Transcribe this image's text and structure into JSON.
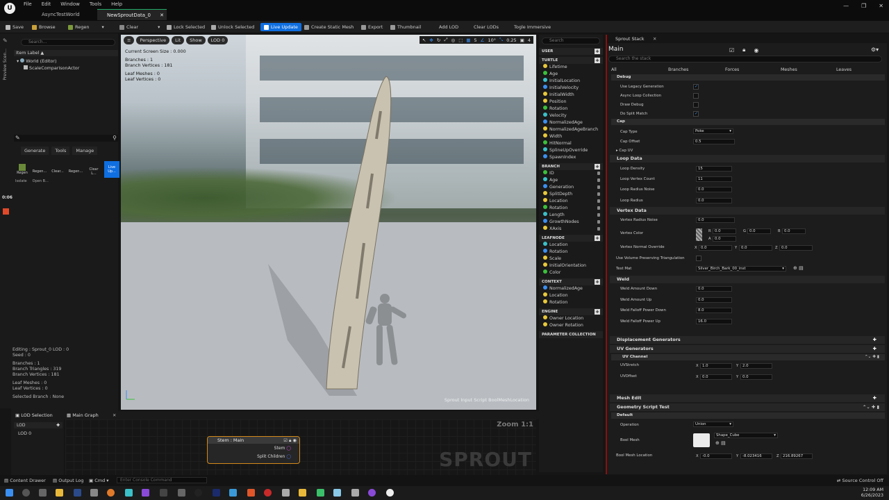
{
  "app": {
    "logo_text": "U",
    "menus": [
      "File",
      "Edit",
      "Window",
      "Tools",
      "Help"
    ],
    "tabs": [
      "AsyncTestWorld",
      "NewSproutData_0"
    ]
  },
  "toolbar": {
    "save": "Save",
    "browse": "Browse",
    "regen": "Regen",
    "clear": "Clear",
    "lock_selected": "Lock Selected",
    "unlock_selected": "Unlock Selected",
    "live_update": "Live Update",
    "create_static_mesh": "Create Static Mesh",
    "export": "Export",
    "thumbnail": "Thumbnail",
    "add_lod": "Add LOD",
    "clear_lods": "Clear LODs",
    "toggle_immersive": "Togle Immersive"
  },
  "side_strip": {
    "label": "Preview Scen..."
  },
  "outliner": {
    "search_placeholder": "Search...",
    "column": "Item Label ▲",
    "items": [
      "World (Editor)",
      "ScaleComparisonActor"
    ]
  },
  "tools": {
    "tabs": [
      "Generate",
      "Tools",
      "Manage"
    ],
    "buttons": [
      "Regen",
      "Regen...",
      "Clear...",
      "Regen...",
      "Clear L...",
      "Live Up..."
    ],
    "row2": [
      "Isolate",
      "Open B..."
    ],
    "timer": "0:06"
  },
  "left_stats": {
    "lines": [
      "Editing : Sprout_0 LOD : 0",
      "Seed : 0",
      "",
      "Branches : 1",
      "Branch Triangles : 319",
      "Branch Vertices : 181",
      "",
      "Leaf Meshes : 0",
      "Leaf Vertices : 0",
      "",
      "Selected Branch : None"
    ]
  },
  "viewport": {
    "buttons": [
      "Perspective",
      "Lit",
      "Show",
      "LOD 0"
    ],
    "stats": [
      "Current Screen Size : 0.000",
      "",
      "Branches : 1",
      "Branch Vertices : 181",
      "",
      "Leaf Meshes : 0",
      "Leaf Vertices : 0"
    ],
    "right_values": [
      "5",
      "10°",
      "0.25",
      "4"
    ],
    "footer": "Sprout Input Script BoolMeshLocation"
  },
  "pins": {
    "search_placeholder": "Search",
    "groups": [
      {
        "header": "USER",
        "items": []
      },
      {
        "header": "TURTLE",
        "items": [
          "Lifetime",
          "Age",
          "InitialLocation",
          "InitialVelocity",
          "InitialWidth",
          "Position",
          "Rotation",
          "Velocity",
          "NormalizedAge",
          "NormalizedAgeBranch",
          "Width",
          "HitNormal",
          "SplineUpOverride",
          "SpawnIndex"
        ]
      },
      {
        "header": "BRANCH",
        "items": [
          "ID",
          "Age",
          "Generation",
          "SplitDepth",
          "Location",
          "Rotation",
          "Length",
          "GrowthNodes",
          "XAxis"
        ]
      },
      {
        "header": "LEAFNODE",
        "items": [
          "Location",
          "Rotation",
          "Scale",
          "InitialOrientation",
          "Color"
        ]
      },
      {
        "header": "CONTEXT",
        "items": [
          "NormalizedAge",
          "Location",
          "Rotation"
        ]
      },
      {
        "header": "ENGINE",
        "items": [
          "Owner Location",
          "Owner Rotation"
        ]
      },
      {
        "header": "PARAMETER COLLECTION",
        "items": []
      }
    ]
  },
  "stack": {
    "panel_title": "Sprout Stack",
    "title": "Main",
    "search_placeholder": "Search the stack",
    "tabs": [
      "All",
      "Branches",
      "Forces",
      "Meshes",
      "Leaves"
    ],
    "debug": {
      "label": "Debug",
      "props": [
        "Use Legacy Generation",
        "Async Loop Collection",
        "Draw Debug",
        "Do Split Match"
      ]
    },
    "cap": {
      "label": "Cap",
      "cap_type_label": "Cap Type",
      "cap_type": "Poke",
      "cap_offset_label": "Cap Offset",
      "cap_offset": "0.5",
      "cap_uv_label": "Cap UV"
    },
    "loop_data": {
      "label": "Loop Data",
      "props": [
        [
          "Loop Density",
          "15"
        ],
        [
          "Loop Vertex Count",
          "11"
        ],
        [
          "Loop Radius Noise",
          "0.0"
        ],
        [
          "Loop Radius",
          "0.0"
        ]
      ]
    },
    "vertex_data": {
      "label": "Vertex Data",
      "radius_noise_label": "Vertex Radius Noise",
      "radius_noise": "0.0",
      "color_label": "Vertex Color",
      "r": "0.0",
      "g": "0.0",
      "b": "0.0",
      "a": "0.0",
      "normal_label": "Vertex Normal Override",
      "nx": "0.0",
      "ny": "0.0",
      "nz": "0.0",
      "volume_label": "Use Volume Preserving Triangulation",
      "test_mat_label": "Test Mat",
      "test_mat": "Silver_Birch_Bark_00_inst"
    },
    "weld": {
      "label": "Weld",
      "props": [
        [
          "Weld Amount Down",
          "0.0"
        ],
        [
          "Weld Amount Up",
          "0.0"
        ],
        [
          "Weld Falloff Power Down",
          "8.0"
        ],
        [
          "Weld Falloff Power Up",
          "16.0"
        ]
      ]
    },
    "displacement": "Displacement Generators",
    "uv_generators": "UV Generators",
    "uv_channel": {
      "label": "UV Channel",
      "stretch_label": "UVStretch",
      "sx": "1.0",
      "sy": "2.0",
      "offset_label": "UVOffset",
      "ox": "0.0",
      "oy": "0.0"
    },
    "mesh_edit": "Mesh Edit",
    "geometry_script": {
      "label": "Geometry Script Test",
      "default": "Default",
      "operation_label": "Operation",
      "operation": "Union",
      "bool_mesh_label": "Bool Mesh",
      "bool_mesh": "Shape_Cube",
      "location_label": "Bool Mesh Location",
      "lx": "-0.0",
      "ly": "-8.023416",
      "lz": "216.89267"
    }
  },
  "bottom": {
    "lod_tab": "LOD Selection",
    "graph_tab": "Main Graph",
    "lod_header": "LOD",
    "lod_item": "LOD 0",
    "zoom": "Zoom 1:1",
    "node": {
      "title": "Stem : Main",
      "pins": [
        "Stem",
        "Split Children"
      ]
    },
    "watermark": "SPROUT"
  },
  "status": {
    "content_drawer": "Content Drawer",
    "output_log": "Output Log",
    "cmd": "Cmd ▾",
    "console_placeholder": "Enter Console Command",
    "source_control": "Source Control Off"
  },
  "clock": {
    "time": "12:09 AM",
    "date": "6/26/2023"
  },
  "colors": {
    "accent": "#0f6ee0",
    "node_outline": "#d48a1a",
    "panel_border": "#8a1010"
  }
}
